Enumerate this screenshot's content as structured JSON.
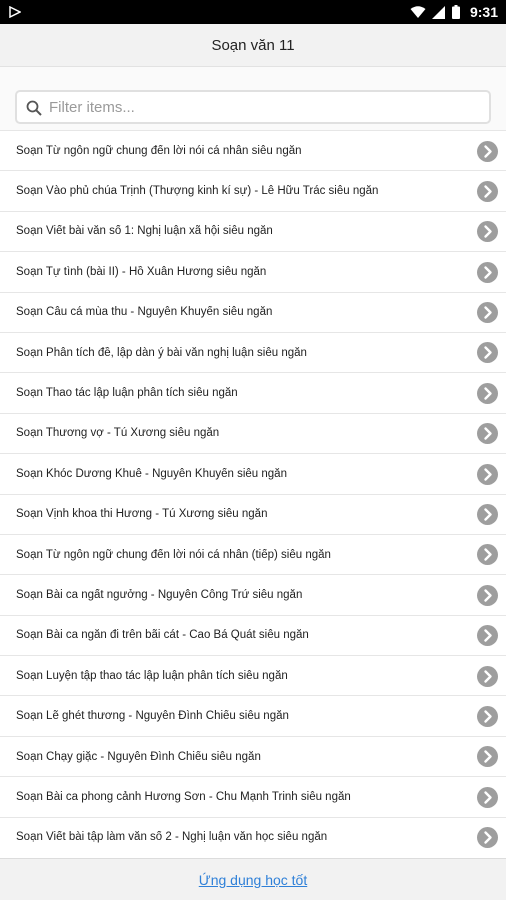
{
  "status_bar": {
    "time": "9:31"
  },
  "header": {
    "title": "Soạn văn 11"
  },
  "search": {
    "placeholder": "Filter items..."
  },
  "items": [
    "Soạn Từ ngôn ngữ chung đến lời nói cá nhân siêu ngắn",
    "Soạn Vào phủ chúa Trịnh (Thượng kinh kí sự) - Lê Hữu Trác siêu ngắn",
    "Soạn Viết bài văn số 1: Nghị luận xã hội siêu ngắn",
    "Soạn Tự tình (bài II) - Hồ Xuân Hương siêu ngắn",
    "Soạn Câu cá mùa thu - Nguyễn Khuyến siêu ngắn",
    "Soạn Phân tích đề, lập dàn ý bài văn nghị luận siêu ngắn",
    "Soạn Thao tác lập luận phân tích siêu ngắn",
    "Soạn Thương vợ - Tú Xương siêu ngắn",
    "Soạn Khóc Dương Khuê - Nguyễn Khuyến siêu ngắn",
    "Soạn Vịnh khoa thi Hương - Tú Xương siêu ngắn",
    "Soạn Từ ngôn ngữ chung đến lời nói cá nhân (tiếp) siêu ngắn",
    "Soạn Bài ca ngất ngưởng - Nguyễn Công Trứ siêu ngắn",
    "Soạn Bài ca ngắn đi trên bãi cát - Cao Bá Quát siêu ngắn",
    "Soạn Luyện tập thao tác lập luận phân tích siêu ngắn",
    "Soạn Lẽ ghét thương - Nguyễn Đình Chiểu siêu ngắn",
    "Soạn Chạy giặc - Nguyễn Đình Chiểu siêu ngắn",
    "Soạn Bài ca phong cảnh Hương Sơn - Chu Mạnh Trinh siêu ngắn",
    "Soạn Viết bài tập làm văn số 2 - Nghị luận văn học siêu ngắn"
  ],
  "footer": {
    "link": "Ứng dụng học tốt"
  },
  "colors": {
    "accent": "#2f80d8",
    "chevron": "#9e9e9e"
  },
  "icons": {
    "status_left": "play-store-icon",
    "status_right": [
      "wifi-icon",
      "signal-icon",
      "battery-icon"
    ],
    "search": "search-icon",
    "item": "chevron-right-icon"
  }
}
